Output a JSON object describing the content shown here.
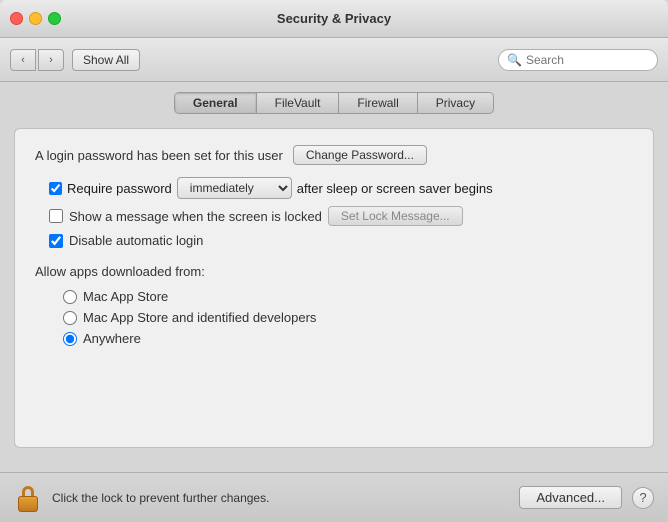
{
  "window": {
    "title": "Security & Privacy"
  },
  "toolbar": {
    "show_all_label": "Show All",
    "search_placeholder": "Search"
  },
  "tabs": [
    {
      "id": "general",
      "label": "General",
      "active": true
    },
    {
      "id": "filevault",
      "label": "FileVault",
      "active": false
    },
    {
      "id": "firewall",
      "label": "Firewall",
      "active": false
    },
    {
      "id": "privacy",
      "label": "Privacy",
      "active": false
    }
  ],
  "general": {
    "login_password_text": "A login password has been set for this user",
    "change_password_label": "Change Password...",
    "require_password_label": "Require password",
    "password_dropdown_value": "immediately",
    "after_sleep_text": "after sleep or screen saver begins",
    "show_message_label": "Show a message when the screen is locked",
    "set_lock_message_label": "Set Lock Message...",
    "disable_auto_login_label": "Disable automatic login",
    "allow_apps_label": "Allow apps downloaded from:",
    "app_store_label": "Mac App Store",
    "app_store_identified_label": "Mac App Store and identified developers",
    "anywhere_label": "Anywhere"
  },
  "bottom_bar": {
    "lock_text": "Click the lock to prevent further changes.",
    "advanced_label": "Advanced...",
    "help_label": "?"
  },
  "checkboxes": {
    "require_password_checked": true,
    "show_message_checked": false,
    "disable_auto_login_checked": true
  },
  "radios": {
    "app_store_selected": false,
    "app_store_identified_selected": false,
    "anywhere_selected": true
  }
}
